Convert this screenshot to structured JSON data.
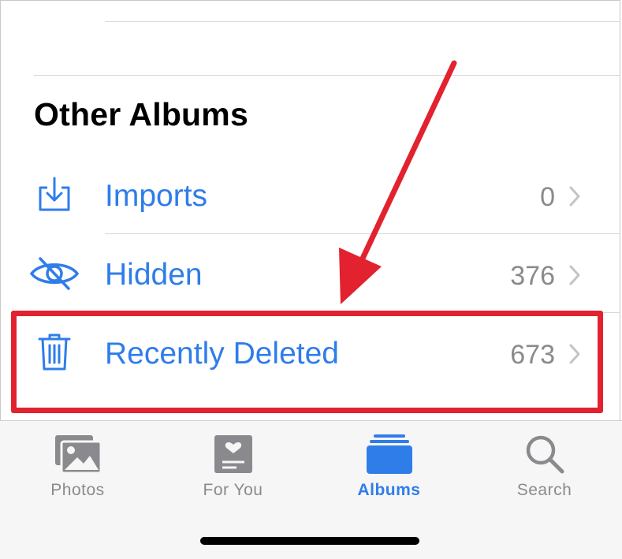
{
  "section": {
    "title": "Other Albums"
  },
  "rows": [
    {
      "label": "Imports",
      "count": "0",
      "icon": "import-tray-icon"
    },
    {
      "label": "Hidden",
      "count": "376",
      "icon": "eye-slash-icon"
    },
    {
      "label": "Recently Deleted",
      "count": "673",
      "icon": "trash-icon"
    }
  ],
  "tabbar": {
    "tabs": [
      {
        "label": "Photos",
        "icon": "photos-icon",
        "active": false
      },
      {
        "label": "For You",
        "icon": "for-you-icon",
        "active": false
      },
      {
        "label": "Albums",
        "icon": "albums-icon",
        "active": true
      },
      {
        "label": "Search",
        "icon": "search-icon",
        "active": false
      }
    ]
  },
  "colors": {
    "accent": "#2f7de9",
    "annotation": "#e2222f",
    "secondary": "#8a8a8e"
  }
}
